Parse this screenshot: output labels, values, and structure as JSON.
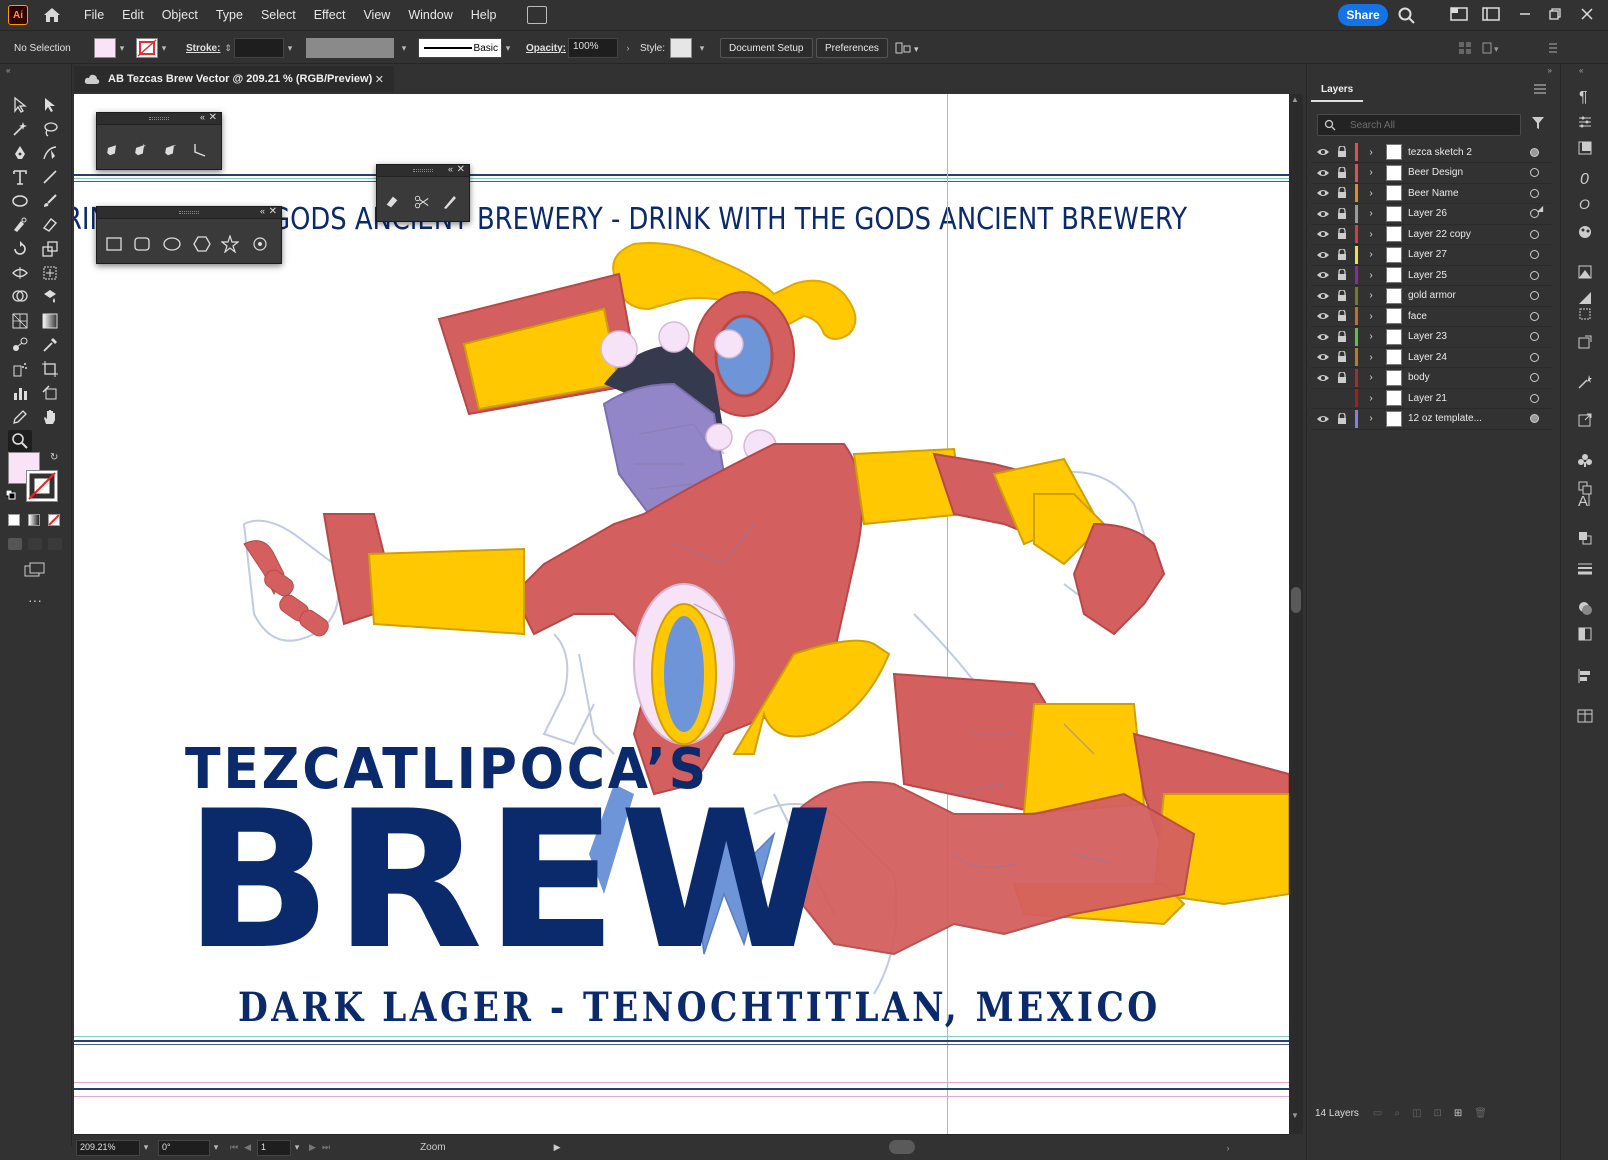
{
  "app": {
    "logo": "Ai",
    "menu": [
      "File",
      "Edit",
      "Object",
      "Type",
      "Select",
      "Effect",
      "View",
      "Window",
      "Help"
    ],
    "share_label": "Share"
  },
  "control_bar": {
    "selection": "No Selection",
    "stroke_label": "Stroke:",
    "stroke_style": "Basic",
    "opacity_label": "Opacity:",
    "opacity_value": "100%",
    "style_label": "Style:",
    "document_setup": "Document Setup",
    "preferences": "Preferences",
    "fill_color": "#fbe3f7",
    "accent": "#1473e6"
  },
  "document": {
    "tab_title": "AB Tezcas Brew Vector @ 209.21 % (RGB/Preview)"
  },
  "artwork": {
    "band_text": "RINK WITH THE GODS   ANCIENT BREWERY - DRINK WITH THE GODS   ANCIENT BREWERY",
    "title_top": "TEZCATLIPOCA’S",
    "title_bottom": "BREW",
    "subtitle": "DARK LAGER - TENOCHTITLAN, MEXICO",
    "colors": {
      "navy": "#0b2a6b",
      "red": "#d45f5f",
      "gold": "#ffc800",
      "blue": "#6e95d8",
      "purple": "#9286c9",
      "pink": "#f7e3f7"
    }
  },
  "status_bar": {
    "zoom": "209.21%",
    "rotation": "0°",
    "artboard": "1",
    "tool": "Zoom"
  },
  "layers_panel": {
    "tab": "Layers",
    "search_placeholder": "Search All",
    "layers": [
      {
        "name": "tezca sketch 2",
        "color": "#e05050",
        "visible": true
      },
      {
        "name": "Beer Design",
        "color": "#e05050",
        "visible": true
      },
      {
        "name": "Beer Name",
        "color": "#e08a2a",
        "visible": true
      },
      {
        "name": "Layer 26",
        "color": "#9a9a9a",
        "visible": true
      },
      {
        "name": "Layer 22 copy",
        "color": "#d04040",
        "visible": true
      },
      {
        "name": "Layer 27",
        "color": "#f0e040",
        "visible": true
      },
      {
        "name": "Layer 25",
        "color": "#8a2aa0",
        "visible": true
      },
      {
        "name": "gold armor",
        "color": "#7a7a20",
        "visible": true
      },
      {
        "name": "face",
        "color": "#c07020",
        "visible": true
      },
      {
        "name": "Layer 23",
        "color": "#60c040",
        "visible": true
      },
      {
        "name": "Layer 24",
        "color": "#c07a20",
        "visible": true
      },
      {
        "name": "body",
        "color": "#a03030",
        "visible": true
      },
      {
        "name": "Layer 21",
        "color": "#a02020",
        "visible": false
      },
      {
        "name": "12 oz template...",
        "color": "#8080e0",
        "visible": true
      }
    ],
    "footer_count": "14 Layers"
  }
}
